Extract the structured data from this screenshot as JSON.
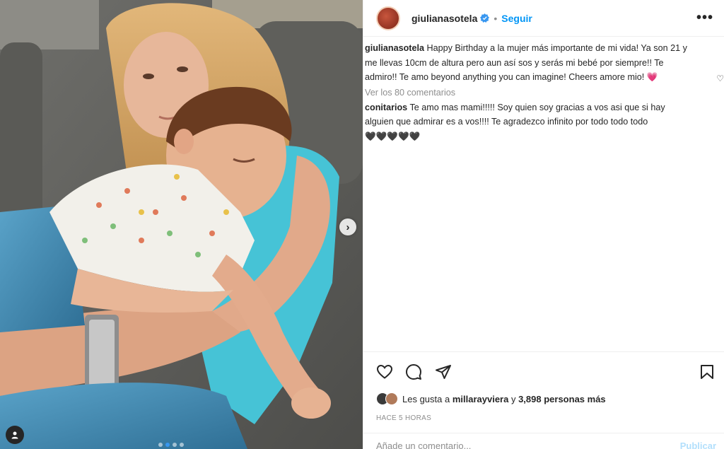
{
  "post": {
    "username": "giulianasotela",
    "follow_label": "Seguir",
    "separator": "•",
    "more_label": "•••",
    "caption_lines": [
      "Happy Birthday a la mujer más importante de mi vida! Ya son 21 y",
      "me llevas 10cm de altura pero aun así sos y serás mi bebé por siempre!! Te",
      "admiro!! Te amo beyond anything you can imagine! Cheers amore mio! 💗"
    ],
    "view_comments": "Ver los 80 comentarios",
    "reply": {
      "username": "conitarios",
      "lines": [
        "Te amo mas mami!!!!! Soy quien soy gracias a vos asi que si hay",
        "alguien que admirar es a vos!!!! Te agradezco infinito por todo todo todo",
        "🖤🖤🖤🖤🖤"
      ]
    },
    "likes": {
      "prefix": "Les gusta a ",
      "user": "millarayviera",
      "middle": " y ",
      "count": "3,898 personas más"
    },
    "time": "HACE 5 HORAS",
    "comment_placeholder": "Añade un comentario...",
    "publish_label": "Publicar"
  },
  "icons": {
    "verified": "verified-badge-icon",
    "like": "heart-icon",
    "comment": "comment-bubble-icon",
    "share": "paper-plane-icon",
    "save": "bookmark-icon",
    "next": "chevron-right-icon",
    "tag": "user-tag-icon"
  },
  "colors": {
    "accent": "#0095f6",
    "verified": "#3897f0",
    "muted": "#8e8e8e"
  },
  "carousel": {
    "slides": 4,
    "active_index": 1
  }
}
